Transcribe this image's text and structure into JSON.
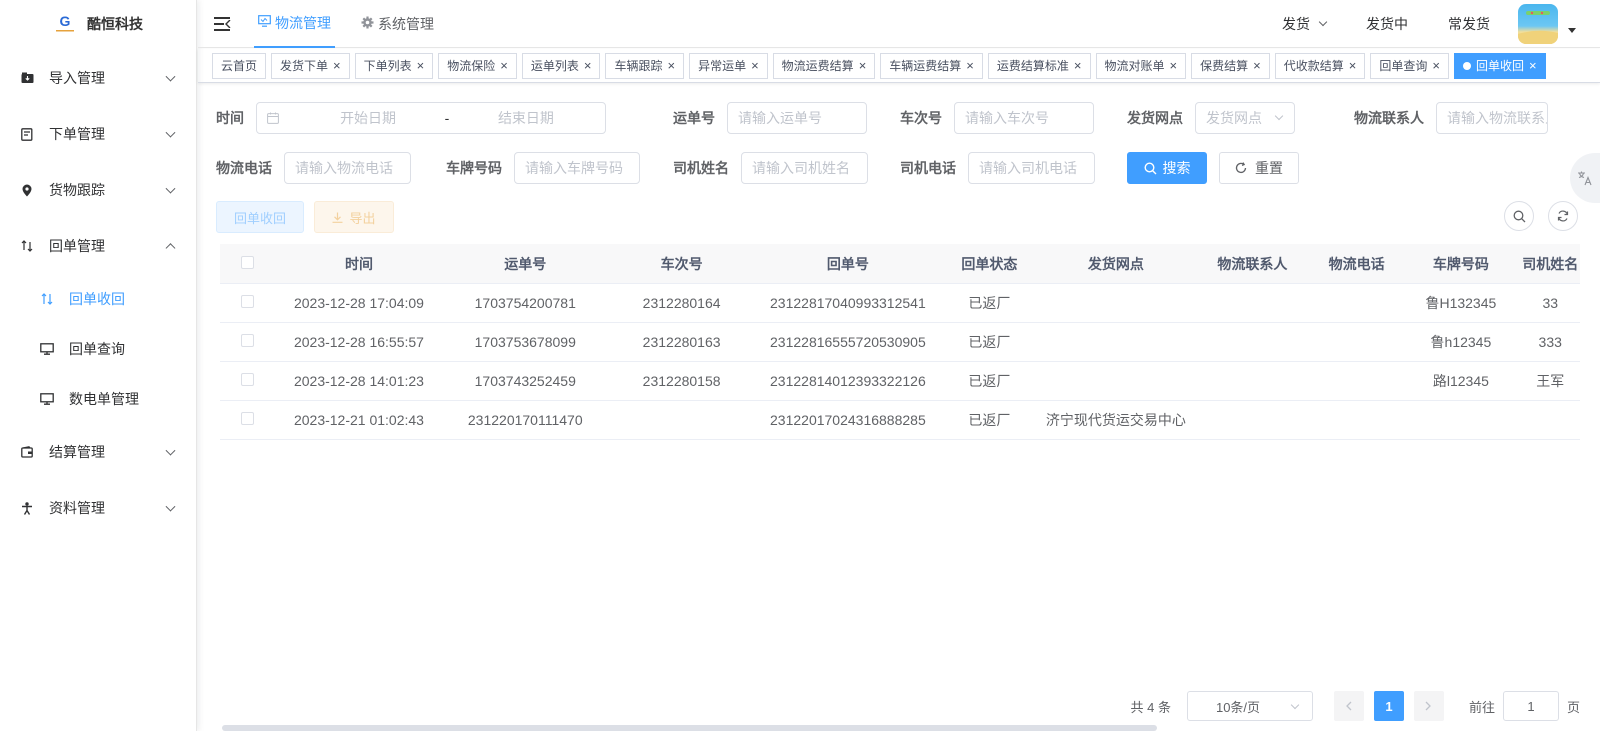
{
  "app": {
    "logo_text": "酷恒科技"
  },
  "sidebar": {
    "items": [
      {
        "label": "导入管理",
        "icon": "import-icon"
      },
      {
        "label": "下单管理",
        "icon": "order-icon"
      },
      {
        "label": "货物跟踪",
        "icon": "location-icon"
      },
      {
        "label": "回单管理",
        "icon": "receipt-icon",
        "expanded": true,
        "children": [
          {
            "label": "回单收回",
            "icon": "transfer-icon",
            "active": true
          },
          {
            "label": "回单查询",
            "icon": "monitor-icon"
          },
          {
            "label": "数电单管理",
            "icon": "monitor-icon"
          }
        ]
      },
      {
        "label": "结算管理",
        "icon": "wallet-icon"
      },
      {
        "label": "资料管理",
        "icon": "person-icon"
      }
    ]
  },
  "header": {
    "tabs": [
      {
        "label": "物流管理",
        "icon": "monitor-icon",
        "active": true
      },
      {
        "label": "系统管理",
        "icon": "gear-icon",
        "active": false
      }
    ],
    "right": {
      "ship": "发货",
      "shipping": "发货中",
      "frequent": "常发货"
    }
  },
  "tags": [
    {
      "label": "云首页",
      "closable": false
    },
    {
      "label": "发货下单",
      "closable": true
    },
    {
      "label": "下单列表",
      "closable": true
    },
    {
      "label": "物流保险",
      "closable": true
    },
    {
      "label": "运单列表",
      "closable": true
    },
    {
      "label": "车辆跟踪",
      "closable": true
    },
    {
      "label": "异常运单",
      "closable": true
    },
    {
      "label": "物流运费结算",
      "closable": true
    },
    {
      "label": "车辆运费结算",
      "closable": true
    },
    {
      "label": "运费结算标准",
      "closable": true
    },
    {
      "label": "物流对账单",
      "closable": true
    },
    {
      "label": "保费结算",
      "closable": true
    },
    {
      "label": "代收款结算",
      "closable": true
    },
    {
      "label": "回单查询",
      "closable": true
    },
    {
      "label": "回单收回",
      "closable": true,
      "active": true
    }
  ],
  "filters": {
    "time": {
      "label": "时间",
      "start_placeholder": "开始日期",
      "separator": "-",
      "end_placeholder": "结束日期"
    },
    "waybill": {
      "label": "运单号",
      "placeholder": "请输入运单号"
    },
    "trip": {
      "label": "车次号",
      "placeholder": "请输入车次号"
    },
    "branch": {
      "label": "发货网点",
      "placeholder": "发货网点"
    },
    "contact": {
      "label": "物流联系人",
      "placeholder": "请输入物流联系人"
    },
    "phone": {
      "label": "物流电话",
      "placeholder": "请输入物流电话"
    },
    "plate": {
      "label": "车牌号码",
      "placeholder": "请输入车牌号码"
    },
    "driver": {
      "label": "司机姓名",
      "placeholder": "请输入司机姓名"
    },
    "driver_phone": {
      "label": "司机电话",
      "placeholder": "请输入司机电话"
    },
    "search_btn": "搜索",
    "reset_btn": "重置"
  },
  "actions": {
    "recover": "回单收回",
    "export": "导出"
  },
  "table": {
    "columns": [
      "时间",
      "运单号",
      "车次号",
      "回单号",
      "回单状态",
      "发货网点",
      "物流联系人",
      "物流电话",
      "车牌号码",
      "司机姓名"
    ],
    "rows": [
      [
        "2023-12-28 17:04:09",
        "1703754200781",
        "2312280164",
        "23122817040993312541",
        "已返厂",
        "",
        "",
        "",
        "鲁H132345",
        "33"
      ],
      [
        "2023-12-28 16:55:57",
        "1703753678099",
        "2312280163",
        "23122816555720530905",
        "已返厂",
        "",
        "",
        "",
        "鲁h12345",
        "333"
      ],
      [
        "2023-12-28 14:01:23",
        "1703743252459",
        "2312280158",
        "23122814012393322126",
        "已返厂",
        "",
        "",
        "",
        "路l12345",
        "王军"
      ],
      [
        "2023-12-21 01:02:43",
        "231220170111470",
        "",
        "23122017024316888285",
        "已返厂",
        "济宁现代货运交易中心",
        "",
        "",
        "",
        ""
      ]
    ]
  },
  "pagination": {
    "total": "共 4 条",
    "page_size": "10条/页",
    "current": "1",
    "goto_label": "前往",
    "goto_value": "1",
    "page_suffix": "页"
  },
  "colors": {
    "primary": "#409eff",
    "border": "#dcdfe6"
  }
}
